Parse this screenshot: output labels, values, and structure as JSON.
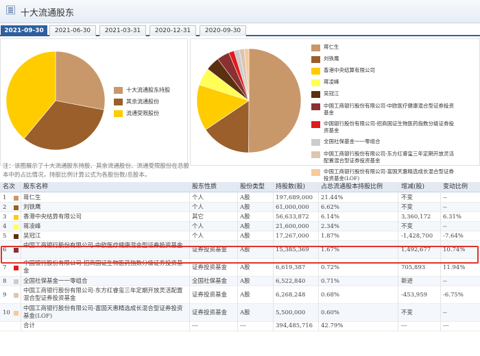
{
  "header": {
    "title": "十大流通股东"
  },
  "tabs": [
    {
      "label": "2021-09-30",
      "active": true
    },
    {
      "label": "2021-06-30",
      "active": false
    },
    {
      "label": "2021-03-31",
      "active": false
    },
    {
      "label": "2020-12-31",
      "active": false
    },
    {
      "label": "2020-09-30",
      "active": false
    }
  ],
  "left_chart": {
    "legend": [
      {
        "label": "十大流通股东持股",
        "color": "#c8986a"
      },
      {
        "label": "其余流通股份",
        "color": "#9a5f2a"
      },
      {
        "label": "流通受限股份",
        "color": "#ffcc00"
      }
    ]
  },
  "right_chart": {
    "legend": [
      {
        "label": "蒋仁生",
        "color": "#c8986a"
      },
      {
        "label": "刘铁鹰",
        "color": "#9a5f2a"
      },
      {
        "label": "香港中央结算有限公司",
        "color": "#ffcc00"
      },
      {
        "label": "蒋凌峰",
        "color": "#ffff55"
      },
      {
        "label": "吴冠江",
        "color": "#5a3010"
      },
      {
        "label": "中国工商银行股份有限公司-中欧医疗健康混合型证券投资基金",
        "color": "#8a3030"
      },
      {
        "label": "中国银行股份有限公司-招商国证生物医药指数分级证券投资基金",
        "color": "#e31a1a"
      },
      {
        "label": "全国社保基金一一零组合",
        "color": "#cccccc"
      },
      {
        "label": "中国工商银行股份有限公司-东方红睿玺三年定期开放灵活配置混合型证券投资基金",
        "color": "#dcc6b2"
      },
      {
        "label": "中国工商银行股份有限公司-富国天惠精选成长混合型证券投资基金(LOF)",
        "color": "#f7c99b"
      }
    ]
  },
  "note": "注：该图展示了十大流通股东持股、其余流通股份、流通受限股份在总股本中的占比情况，持股比例计算公式为各股份数/总股本。",
  "table": {
    "headers": [
      "名次",
      "股东名称",
      "股东性质",
      "股份类型",
      "持股数(股)",
      "占总流通股本持股比例",
      "增减(股)",
      "变动比例"
    ],
    "rows": [
      {
        "rank": "1",
        "name": "蒋仁生",
        "nature": "个人",
        "type": "A股",
        "shares": "197,689,000",
        "ratio": "21.44%",
        "change": "不变",
        "change_pct": "--",
        "color": "#c8986a"
      },
      {
        "rank": "2",
        "name": "刘铁鹰",
        "nature": "个人",
        "type": "A股",
        "shares": "61,000,000",
        "ratio": "6.62%",
        "change": "不变",
        "change_pct": "--",
        "color": "#9a5f2a"
      },
      {
        "rank": "3",
        "name": "香港中央结算有限公司",
        "nature": "其它",
        "type": "A股",
        "shares": "56,633,872",
        "ratio": "6.14%",
        "change": "3,360,172",
        "change_pct": "6.31%",
        "color": "#ffcc00"
      },
      {
        "rank": "4",
        "name": "蒋凌峰",
        "nature": "个人",
        "type": "A股",
        "shares": "21,600,000",
        "ratio": "2.34%",
        "change": "不变",
        "change_pct": "--",
        "color": "#ffff55"
      },
      {
        "rank": "5",
        "name": "吴冠江",
        "nature": "个人",
        "type": "A股",
        "shares": "17,267,000",
        "ratio": "1.87%",
        "change": "-1,428,700",
        "change_pct": "-7.64%",
        "color": "#5a3010"
      },
      {
        "rank": "6",
        "name": "中国工商银行股份有限公司-中欧医疗健康混合型证券投资基金",
        "nature": "证券投资基金",
        "type": "A股",
        "shares": "15,385,369",
        "ratio": "1.67%",
        "change": "1,492,677",
        "change_pct": "10.74%",
        "color": "#8a3030"
      },
      {
        "rank": "7",
        "name": "中国银行股份有限公司-招商国证生物医药指数分级证券投资基金",
        "nature": "证券投资基金",
        "type": "A股",
        "shares": "6,619,387",
        "ratio": "0.72%",
        "change": "705,893",
        "change_pct": "11.94%",
        "color": "#e31a1a"
      },
      {
        "rank": "8",
        "name": "全国社保基金一一零组合",
        "nature": "全国社保基金",
        "type": "A股",
        "shares": "6,522,840",
        "ratio": "0.71%",
        "change": "新进",
        "change_pct": "--",
        "color": "#cccccc"
      },
      {
        "rank": "9",
        "name": "中国工商银行股份有限公司-东方红睿玺三年定期开放灵活配置混合型证券投资基金",
        "nature": "证券投资基金",
        "type": "A股",
        "shares": "6,268,248",
        "ratio": "0.68%",
        "change": "-453,959",
        "change_pct": "-6.75%",
        "color": "#dcc6b2"
      },
      {
        "rank": "10",
        "name": "中国工商银行股份有限公司-富国天惠精选成长混合型证券投资基金(LOF)",
        "nature": "证券投资基金",
        "type": "A股",
        "shares": "5,500,000",
        "ratio": "0.60%",
        "change": "不变",
        "change_pct": "--",
        "color": "#f7c99b"
      }
    ],
    "total": {
      "label": "合计",
      "nature": "---",
      "type": "---",
      "shares": "394,485,716",
      "ratio": "42.79%",
      "change": "---",
      "change_pct": "---"
    }
  },
  "chart_data": [
    {
      "type": "pie",
      "labels": [
        "十大流通股东持股",
        "其余流通股份",
        "流通受限股份"
      ],
      "values": [
        28,
        33,
        39
      ],
      "colors": [
        "#c8986a",
        "#9a5f2a",
        "#ffcc00"
      ]
    },
    {
      "type": "pie",
      "labels": [
        "蒋仁生",
        "刘铁鹰",
        "香港中央结算有限公司",
        "蒋凌峰",
        "吴冠江",
        "中国工商银行股份有限公司-中欧医疗健康混合型证券投资基金",
        "中国银行股份有限公司-招商国证生物医药指数分级证券投资基金",
        "全国社保基金一一零组合",
        "中国工商银行股份有限公司-东方红睿玺三年定期开放灵活配置混合型证券投资基金",
        "中国工商银行股份有限公司-富国天惠精选成长混合型证券投资基金(LOF)"
      ],
      "values": [
        197689000,
        61000000,
        56633872,
        21600000,
        17267000,
        15385369,
        6619387,
        6522840,
        6268248,
        5500000
      ],
      "colors": [
        "#c8986a",
        "#9a5f2a",
        "#ffcc00",
        "#ffff55",
        "#5a3010",
        "#8a3030",
        "#e31a1a",
        "#cccccc",
        "#dcc6b2",
        "#f7c99b"
      ]
    }
  ]
}
